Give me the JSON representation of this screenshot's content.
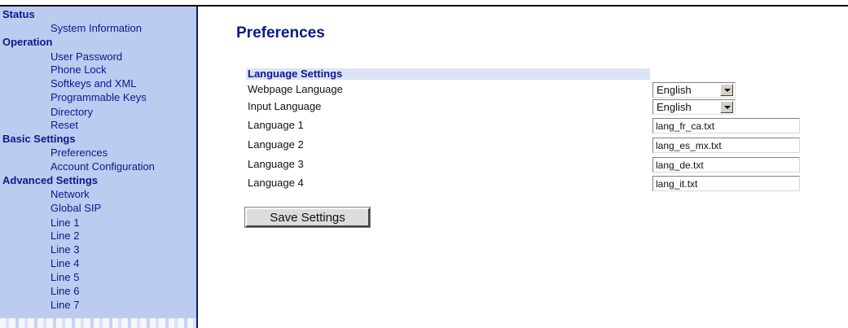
{
  "sidebar": {
    "status": {
      "label": "Status",
      "items": [
        "System Information"
      ]
    },
    "operation": {
      "label": "Operation",
      "items": [
        "User Password",
        "Phone Lock",
        "Softkeys and XML",
        "Programmable Keys",
        "Directory",
        "Reset"
      ]
    },
    "basic_settings": {
      "label": "Basic Settings",
      "items": [
        "Preferences",
        "Account Configuration"
      ]
    },
    "advanced_settings": {
      "label": "Advanced Settings",
      "items": [
        "Network",
        "Global SIP",
        "Line 1",
        "Line 2",
        "Line 3",
        "Line 4",
        "Line 5",
        "Line 6",
        "Line 7"
      ]
    }
  },
  "main": {
    "title": "Preferences",
    "section_title": "Language Settings",
    "webpage_language": {
      "label": "Webpage Language",
      "value": "English"
    },
    "input_language": {
      "label": "Input Language",
      "value": "English"
    },
    "languages": [
      {
        "label": "Language 1",
        "value": "lang_fr_ca.txt"
      },
      {
        "label": "Language 2",
        "value": "lang_es_mx.txt"
      },
      {
        "label": "Language 3",
        "value": "lang_de.txt"
      },
      {
        "label": "Language 4",
        "value": "lang_it.txt"
      }
    ],
    "save_label": "Save Settings"
  },
  "colors": {
    "sidebar_bg": "#bccbf0",
    "link": "#0a1a8a",
    "section_bar": "#dde3f6"
  }
}
